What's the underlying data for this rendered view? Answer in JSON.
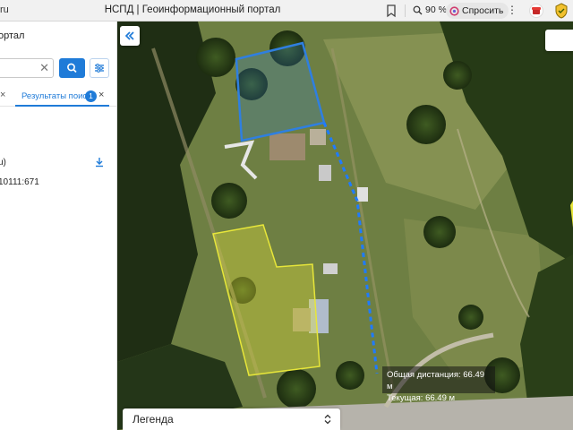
{
  "browser": {
    "left_text": "ru",
    "tab_title": "НСПД | Геоинформационный портал",
    "zoom": "90 %",
    "ask_label": "Спросить",
    "menu_icon": "ellipsis-icon"
  },
  "sidebar": {
    "title": "ортал",
    "search": {
      "value": "",
      "placeholder": ""
    },
    "tabs": [
      {
        "label": "Результаты поиска",
        "badge": "1"
      }
    ],
    "results": [
      {
        "label": "u)"
      },
      {
        "label": "10111:671"
      }
    ]
  },
  "map": {
    "measure": {
      "total_label": "Общая дистанция: 66.49 м",
      "current_label": "Текущая: 66.49 м"
    },
    "legend_label": "Легенда",
    "colors": {
      "selected_parcel": "#2f7fe0",
      "other_parcel": "#e7e63a",
      "measure_line": "#1f7bff"
    }
  }
}
